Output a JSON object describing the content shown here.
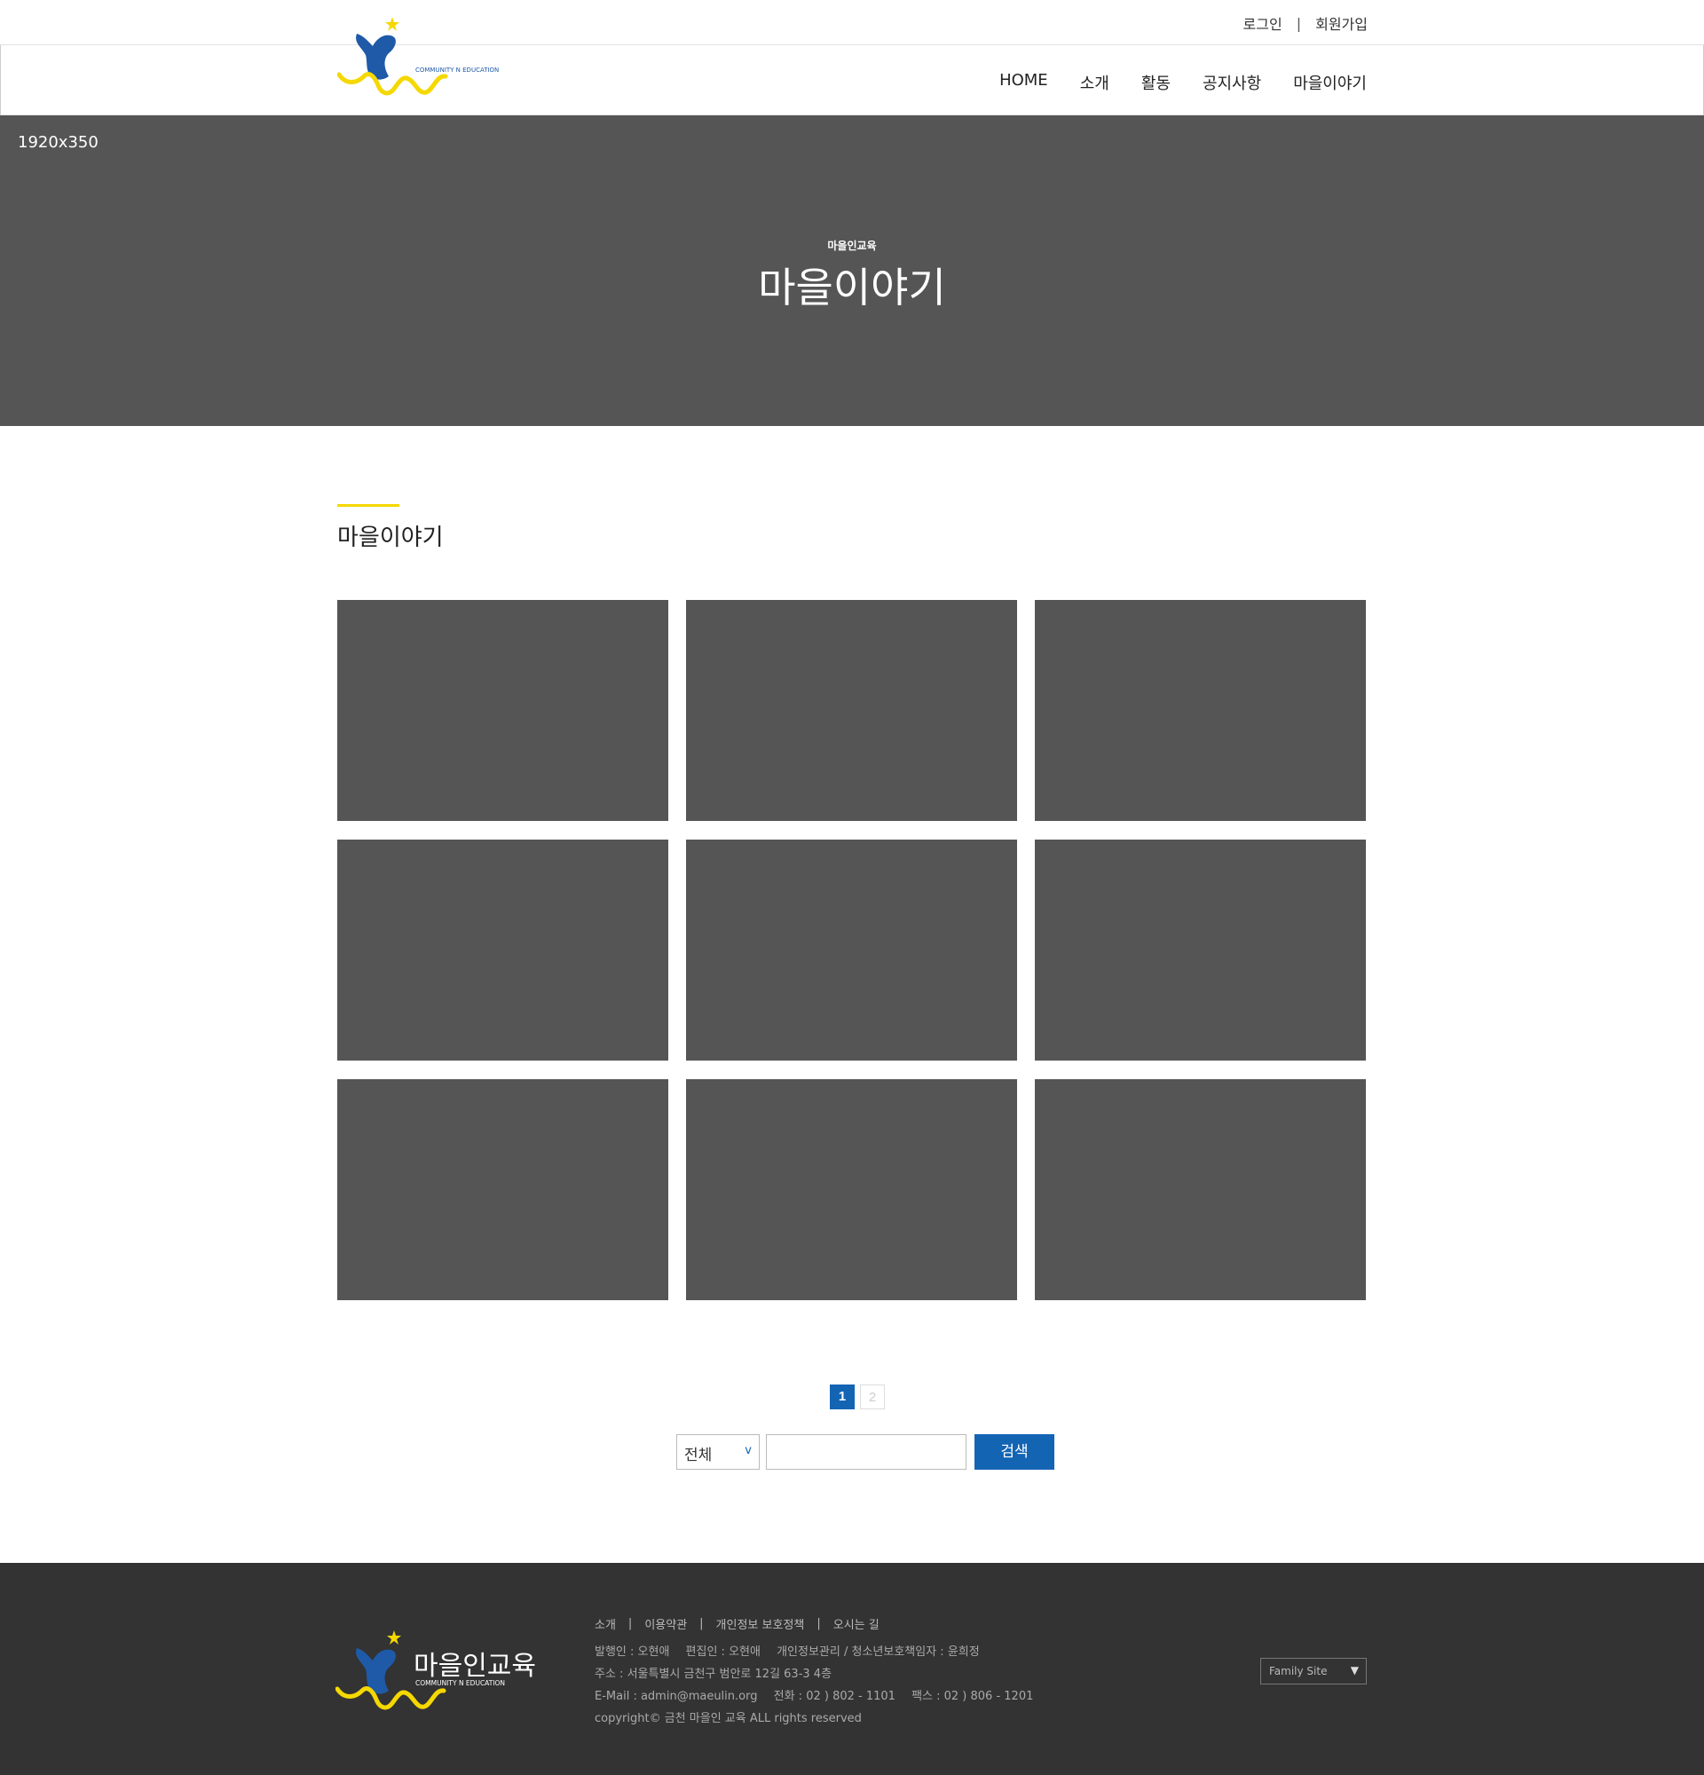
{
  "header": {
    "util_links": [
      "로그인",
      "회원가입"
    ],
    "util_sep": "|",
    "logo": {
      "tagline": "COMMUNITY N EDUCATION"
    },
    "nav": [
      "HOME",
      "소개",
      "활동",
      "공지사항",
      "마을이야기"
    ]
  },
  "hero": {
    "size_label": "1920x350",
    "subtitle": "마을인교육",
    "title": "마을이야기"
  },
  "section": {
    "title": "마을이야기"
  },
  "gallery": {
    "count": 9,
    "placeholder_color": "#555555"
  },
  "pagination": {
    "pages": [
      "1",
      "2"
    ],
    "current": "1"
  },
  "search": {
    "select_value": "전체",
    "select_arrow": "v",
    "button": "검색",
    "input_value": ""
  },
  "footer": {
    "logo": {
      "name": "마을인교육",
      "tagline": "COMMUNITY N EDUCATION"
    },
    "links": [
      "소개",
      "이용약관",
      "개인정보 보호정책",
      "오시는 길"
    ],
    "link_sep": "|",
    "info": {
      "publisher": "발행인 : 오현애",
      "editor": "편집인 : 오현애",
      "privacy": "개인정보관리 / 청소년보호책임자 : 윤희정",
      "address": "주소 : 서울특별시 금천구 범안로 12길 63-3 4층",
      "email": "E-Mail : admin@maeulin.org",
      "phone": "전화 : 02 ) 802 - 1101",
      "fax": "팩스 : 02 ) 806 - 1201",
      "copyright": "copyright© 금천 마을인 교육 ALL rights reserved"
    },
    "family_site": {
      "label": "Family Site",
      "arrow": "▼"
    }
  },
  "colors": {
    "accent": "#1464b4",
    "yellow": "#f5d800",
    "placeholder": "#555555",
    "footer_bg": "#333333"
  },
  "icons": [
    "logo-mark-icon",
    "star-icon",
    "select-arrow-icon",
    "dropdown-arrow-icon"
  ]
}
